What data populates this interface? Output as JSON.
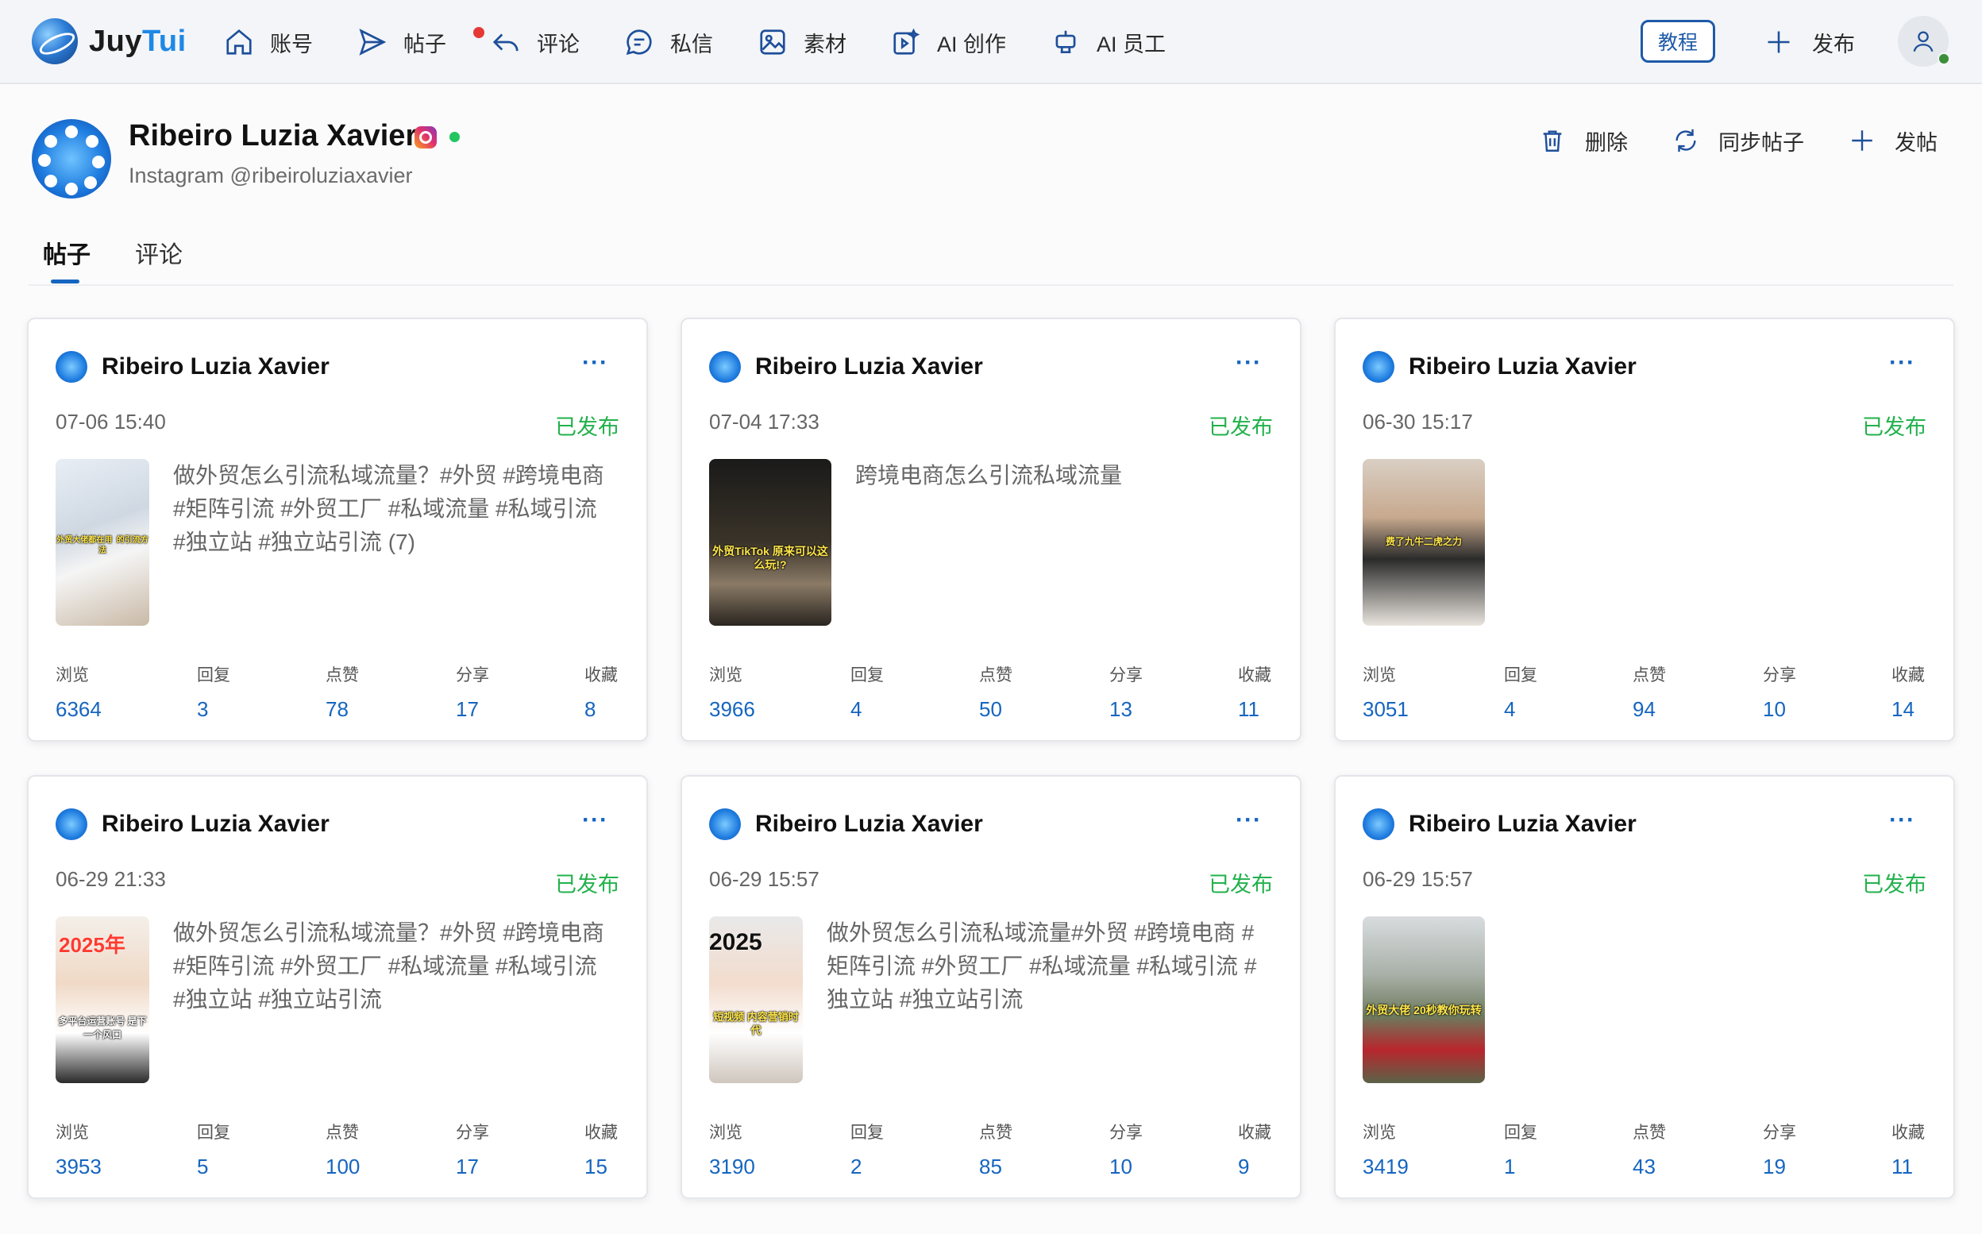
{
  "app": {
    "logo_part1": "Juy",
    "logo_part2": "Tui",
    "nav": [
      {
        "label": "账号",
        "icon": "home-icon"
      },
      {
        "label": "帖子",
        "icon": "send-icon"
      },
      {
        "label": "评论",
        "icon": "reply-icon"
      },
      {
        "label": "私信",
        "icon": "message-icon"
      },
      {
        "label": "素材",
        "icon": "image-icon"
      },
      {
        "label": "AI 创作",
        "icon": "ai-create-icon"
      },
      {
        "label": "AI 员工",
        "icon": "robot-icon"
      }
    ],
    "tutorial_label": "教程",
    "publish_label": "发布"
  },
  "profile": {
    "name": "Ribeiro Luzia Xavier",
    "handle": "Instagram @ribeiroluziaxavier",
    "actions": {
      "delete": "删除",
      "sync": "同步帖子",
      "post": "发帖"
    }
  },
  "tabs": [
    "帖子",
    "评论"
  ],
  "stat_labels": [
    "浏览",
    "回复",
    "点赞",
    "分享",
    "收藏"
  ],
  "posts": [
    {
      "author": "Ribeiro Luzia Xavier",
      "more": "···",
      "date": "07-06 15:40",
      "status": "已发布",
      "text": "做外贸怎么引流私域流量？#外贸 #跨境电商 #矩阵引流 #外贸工厂 #私域流量 #私域引流 #独立站 #独立站引流 (7)",
      "thumb_caption": "外贸大佬都在用  的引流方法",
      "stats": [
        "6364",
        "3",
        "78",
        "17",
        "8"
      ]
    },
    {
      "author": "Ribeiro Luzia Xavier",
      "more": "···",
      "date": "07-04 17:33",
      "status": "已发布",
      "text": "跨境电商怎么引流私域流量",
      "thumb_caption": "外贸TikTok 原来可以这么玩!?",
      "stats": [
        "3966",
        "4",
        "50",
        "13",
        "11"
      ]
    },
    {
      "author": "Ribeiro Luzia Xavier",
      "more": "···",
      "date": "06-30 15:17",
      "status": "已发布",
      "text": "",
      "thumb_caption": "费了九牛二虎之力",
      "stats": [
        "3051",
        "4",
        "94",
        "10",
        "14"
      ]
    },
    {
      "author": "Ribeiro Luzia Xavier",
      "more": "···",
      "date": "06-29 21:33",
      "status": "已发布",
      "text": "做外贸怎么引流私域流量？#外贸 #跨境电商 #矩阵引流 #外贸工厂 #私域流量 #私域引流 #独立站 #独立站引流",
      "thumb_title": "2025年",
      "thumb_caption": "多平台运营账号 是下一个风口",
      "stats": [
        "3953",
        "5",
        "100",
        "17",
        "15"
      ]
    },
    {
      "author": "Ribeiro Luzia Xavier",
      "more": "···",
      "date": "06-29 15:57",
      "status": "已发布",
      "text": "做外贸怎么引流私域流量#外贸 #跨境电商 #矩阵引流 #外贸工厂 #私域流量 #私域引流 #独立站 #独立站引流",
      "thumb_title": "2025",
      "thumb_caption": "短视频 内容营销时代",
      "stats": [
        "3190",
        "2",
        "85",
        "10",
        "9"
      ]
    },
    {
      "author": "Ribeiro Luzia Xavier",
      "more": "···",
      "date": "06-29 15:57",
      "status": "已发布",
      "text": "",
      "thumb_caption": "外贸大佬 20秒教你玩转",
      "stats": [
        "3419",
        "1",
        "43",
        "19",
        "11"
      ]
    }
  ],
  "colors": {
    "accent": "#1565c0",
    "published": "#22b14c",
    "badge": "#e53935"
  }
}
